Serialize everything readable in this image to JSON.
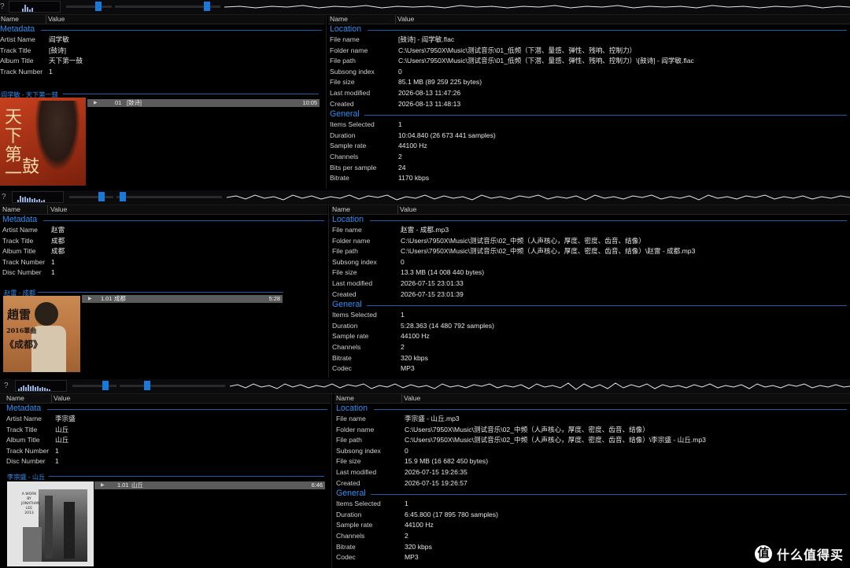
{
  "columns": {
    "name": "Name",
    "value": "Value"
  },
  "toolbar": {
    "help_glyph": "?"
  },
  "sections": {
    "metadata": "Metadata",
    "location": "Location",
    "general": "General"
  },
  "labels": {
    "artist": "Artist Name",
    "track_title": "Track Title",
    "album_title": "Album Title",
    "track_number": "Track Number",
    "disc_number": "Disc Number",
    "file_name": "File name",
    "folder_name": "Folder name",
    "file_path": "File path",
    "subsong_index": "Subsong index",
    "file_size": "File size",
    "last_modified": "Last modified",
    "created": "Created",
    "items_selected": "Items Selected",
    "duration": "Duration",
    "sample_rate": "Sample rate",
    "channels": "Channels",
    "bits_per_sample": "Bits per sample",
    "bitrate": "Bitrate",
    "codec": "Codec"
  },
  "panels": [
    {
      "meta": {
        "artist": "阎学敏",
        "track_title": "[鼓诗]",
        "album_title": "天下第一鼓",
        "track_number": "1"
      },
      "album_header": "阎学敏 - 天下第一鼓",
      "track": {
        "number": "01",
        "title": "[鼓诗]",
        "duration": "10:05"
      },
      "location": {
        "file_name": "[鼓诗] - 阎学敏.flac",
        "folder_name": "C:\\Users\\7950X\\Music\\测试音乐\\01_低频（下潜、量感、弹性、残响、控制力）",
        "file_path": "C:\\Users\\7950X\\Music\\测试音乐\\01_低频（下潜、量感、弹性、残响、控制力）\\[鼓诗] - 阎学敏.flac",
        "subsong_index": "0",
        "file_size": "85.1 MB (89 259 225 bytes)",
        "last_modified": "2026-08-13 11:47:26",
        "created": "2026-08-13 11:48:13"
      },
      "general": {
        "items_selected": "1",
        "duration": "10:04.840 (26 673 441 samples)",
        "sample_rate": "44100 Hz",
        "channels": "2",
        "bits_per_sample": "24",
        "bitrate": "1170 kbps"
      }
    },
    {
      "meta": {
        "artist": "赵雷",
        "track_title": "成都",
        "album_title": "成都",
        "track_number": "1",
        "disc_number": "1"
      },
      "album_header": "赵雷 - 成都",
      "cover_text": {
        "line1": "趙雷",
        "line2": "2016單曲",
        "line3": "《成都》"
      },
      "track": {
        "number": "1.01",
        "title": "成都",
        "duration": "5:28"
      },
      "location": {
        "file_name": "赵雷 - 成都.mp3",
        "folder_name": "C:\\Users\\7950X\\Music\\测试音乐\\02_中频（人声核心，厚度、密度、齿音、结像）",
        "file_path": "C:\\Users\\7950X\\Music\\测试音乐\\02_中频（人声核心，厚度、密度、齿音、结像）\\赵雷 - 成都.mp3",
        "subsong_index": "0",
        "file_size": "13.3 MB (14 008 440 bytes)",
        "last_modified": "2026-07-15 23:01:33",
        "created": "2026-07-15 23:01:39"
      },
      "general": {
        "items_selected": "1",
        "duration": "5:28.363 (14 480 792 samples)",
        "sample_rate": "44100 Hz",
        "channels": "2",
        "bitrate": "320 kbps",
        "codec": "MP3"
      }
    },
    {
      "meta": {
        "artist": "李宗盛",
        "track_title": "山丘",
        "album_title": "山丘",
        "track_number": "1",
        "disc_number": "1"
      },
      "album_header": "李宗盛 - 山丘",
      "cover_text": {
        "line1": "A WORK",
        "line2": "BY",
        "line3": "JONATHAN",
        "line4": "LEE",
        "line5": "2013"
      },
      "track": {
        "number": "1.01",
        "title": "山丘",
        "duration": "6:46"
      },
      "location": {
        "file_name": "李宗盛 - 山丘.mp3",
        "folder_name": "C:\\Users\\7950X\\Music\\测试音乐\\02_中频（人声核心，厚度、密度、齿音、结像）",
        "file_path": "C:\\Users\\7950X\\Music\\测试音乐\\02_中频（人声核心，厚度、密度、齿音、结像）\\李宗盛 - 山丘.mp3",
        "subsong_index": "0",
        "file_size": "15.9 MB (16 682 450 bytes)",
        "last_modified": "2026-07-15 19:26:35",
        "created": "2026-07-15 19:26:57"
      },
      "general": {
        "items_selected": "1",
        "duration": "6:45.800 (17 895 780 samples)",
        "sample_rate": "44100 Hz",
        "channels": "2",
        "bitrate": "320 kbps",
        "codec": "MP3"
      }
    }
  ],
  "watermark": {
    "logo": "值",
    "text": "什么值得买"
  }
}
